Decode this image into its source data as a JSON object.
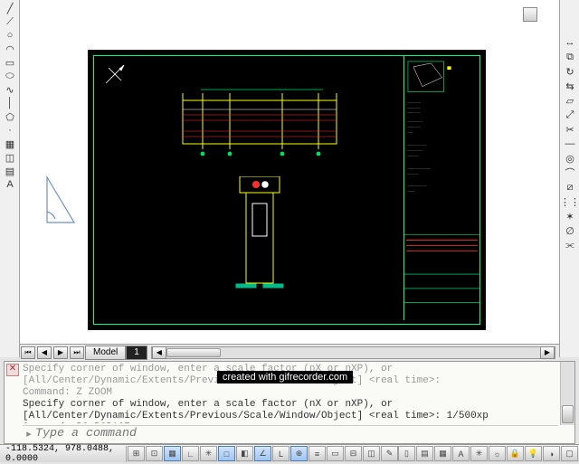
{
  "left_tools": [
    {
      "name": "line-icon",
      "glyph": "╱"
    },
    {
      "name": "polyline-icon",
      "glyph": "⟋"
    },
    {
      "name": "circle-icon",
      "glyph": "○"
    },
    {
      "name": "arc-icon",
      "glyph": "◠"
    },
    {
      "name": "rectangle-icon",
      "glyph": "▭"
    },
    {
      "name": "ellipse-icon",
      "glyph": "⬭"
    },
    {
      "name": "spline-icon",
      "glyph": "∿"
    },
    {
      "name": "construction-line-icon",
      "glyph": "│"
    },
    {
      "name": "polygon-icon",
      "glyph": "⬠"
    },
    {
      "name": "point-icon",
      "glyph": "·"
    },
    {
      "name": "hatch-icon",
      "glyph": "▦"
    },
    {
      "name": "region-icon",
      "glyph": "◫"
    },
    {
      "name": "table-icon",
      "glyph": "▤"
    },
    {
      "name": "text-icon",
      "glyph": "A"
    }
  ],
  "right_tools": [
    {
      "name": "move-icon",
      "glyph": "↔"
    },
    {
      "name": "copy-icon",
      "glyph": "⧉"
    },
    {
      "name": "rotate-icon",
      "glyph": "↻"
    },
    {
      "name": "mirror-icon",
      "glyph": "⇆"
    },
    {
      "name": "scale-icon",
      "glyph": "▱"
    },
    {
      "name": "stretch-icon",
      "glyph": "⤢"
    },
    {
      "name": "trim-icon",
      "glyph": "✂"
    },
    {
      "name": "extend-icon",
      "glyph": "—"
    },
    {
      "name": "offset-icon",
      "glyph": "◎"
    },
    {
      "name": "fillet-icon",
      "glyph": "⌒"
    },
    {
      "name": "chamfer-icon",
      "glyph": "⧄"
    },
    {
      "name": "array-icon",
      "glyph": "⋮⋮"
    },
    {
      "name": "explode-icon",
      "glyph": "✶"
    },
    {
      "name": "erase-icon",
      "glyph": "∅"
    },
    {
      "name": "join-icon",
      "glyph": "⫘"
    }
  ],
  "tabs": {
    "model_label": "Model",
    "layout_label": "1"
  },
  "command": {
    "line1": "Specify corner of window, enter a scale factor (nX or nXP), or",
    "line2": "[All/Center/Dynamic/Extents/Previous/Scale/Window/Object] <real time>:",
    "line3": "Command: Z ZOOM",
    "line4": "Specify corner of window, enter a scale factor (nX or nXP), or",
    "line5": "[All/Center/Dynamic/Extents/Previous/Scale/Window/Object] <real time>: 1/500xp",
    "line6": "Command: PS PSPACE",
    "placeholder": "Type a command"
  },
  "watermark": "created with gifrecorder.com",
  "status": {
    "coords": "-118.5324, 978.0488, 0.0000"
  },
  "status_buttons_left": [
    {
      "name": "infer-constraints-icon",
      "glyph": "⊞"
    },
    {
      "name": "snap-icon",
      "glyph": "⊡",
      "on": false
    },
    {
      "name": "grid-icon",
      "glyph": "▦",
      "on": true
    },
    {
      "name": "ortho-icon",
      "glyph": "∟",
      "on": false
    },
    {
      "name": "polar-icon",
      "glyph": "✳",
      "on": false
    },
    {
      "name": "osnap-icon",
      "glyph": "□",
      "on": true
    },
    {
      "name": "3dosnap-icon",
      "glyph": "◧",
      "on": false
    },
    {
      "name": "otrack-icon",
      "glyph": "∠",
      "on": true
    },
    {
      "name": "ducs-icon",
      "glyph": "L",
      "on": false
    },
    {
      "name": "dyn-icon",
      "glyph": "⊕",
      "on": true
    },
    {
      "name": "lwt-icon",
      "glyph": "≡",
      "on": false
    },
    {
      "name": "tpy-icon",
      "glyph": "▭",
      "on": false
    },
    {
      "name": "qp-icon",
      "glyph": "⊟",
      "on": false
    },
    {
      "name": "sc-icon",
      "glyph": "◫",
      "on": false
    },
    {
      "name": "am-icon",
      "glyph": "✎",
      "on": false
    }
  ],
  "status_buttons_right": [
    {
      "name": "model-paper-toggle",
      "glyph": "▯"
    },
    {
      "name": "quick-view-layouts-icon",
      "glyph": "▤"
    },
    {
      "name": "quick-view-drawings-icon",
      "glyph": "▦"
    },
    {
      "name": "annotation-scale-icon",
      "glyph": "A"
    },
    {
      "name": "annotation-visibility-icon",
      "glyph": "✳"
    },
    {
      "name": "workspace-icon",
      "glyph": "☼"
    },
    {
      "name": "toolbar-lock-icon",
      "glyph": "🔒"
    },
    {
      "name": "hardware-accel-icon",
      "glyph": "💡"
    },
    {
      "name": "isolate-icon",
      "glyph": "◑"
    },
    {
      "name": "clean-screen-icon",
      "glyph": "▢"
    }
  ]
}
